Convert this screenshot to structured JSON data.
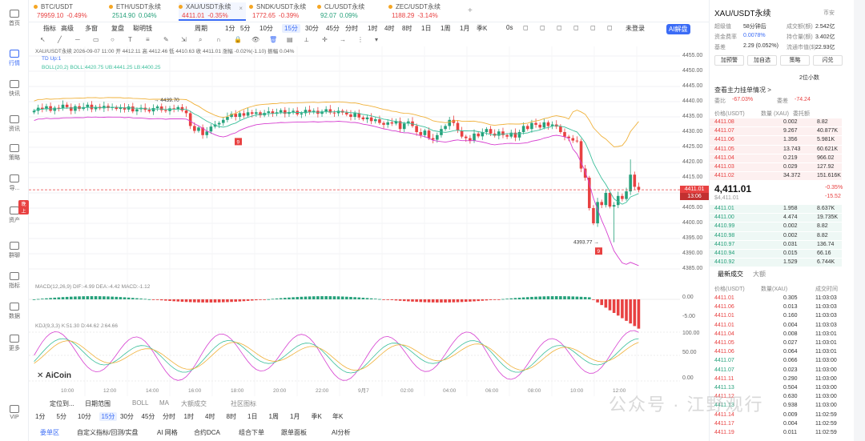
{
  "nav": [
    {
      "label": "首页",
      "icon": "home-icon"
    },
    {
      "label": "行情",
      "icon": "chart-icon"
    },
    {
      "label": "快讯",
      "icon": "flash-icon"
    },
    {
      "label": "资讯",
      "icon": "news-icon"
    },
    {
      "label": "策略",
      "icon": "strategy-icon"
    },
    {
      "label": "导...",
      "icon": "nav-icon"
    },
    {
      "label": "资产",
      "icon": "asset-icon",
      "badge": "晚上"
    },
    {
      "label": "群聊",
      "icon": "chat-icon"
    },
    {
      "label": "指标",
      "icon": "indicator-icon"
    },
    {
      "label": "数据",
      "icon": "data-icon"
    },
    {
      "label": "更多",
      "icon": "more-icon"
    },
    {
      "label": "VIP",
      "icon": "vip-icon"
    }
  ],
  "tabs": [
    {
      "name": "BTC/USDT",
      "price": "79959.10",
      "change": "-0.49%",
      "dir": "dn"
    },
    {
      "name": "ETH/USDT永续",
      "price": "2514.90",
      "change": "0.04%",
      "dir": "up"
    },
    {
      "name": "XAU/USDT永续",
      "price": "4411.01",
      "change": "-0.35%",
      "dir": "dn"
    },
    {
      "name": "SNDK/USDT永续",
      "price": "1772.65",
      "change": "-0.39%",
      "dir": "dn"
    },
    {
      "name": "CL/USDT永续",
      "price": "92.07",
      "change": "0.09%",
      "dir": "up"
    },
    {
      "name": "ZEC/USDT永续",
      "price": "1188.29",
      "change": "-3.14%",
      "dir": "dn"
    }
  ],
  "toolbar1": [
    "指标",
    "高级",
    "多窗",
    "复盘",
    "聪明钱",
    "周期",
    "1分",
    "5分",
    "10分",
    "15分",
    "30分",
    "45分",
    "分时",
    "1时",
    "4时",
    "8时",
    "1日",
    "1周",
    "1月",
    "季K",
    "0s",
    "未登录",
    "AI解盘"
  ],
  "toolbar2_label": "画线工具",
  "chart_header": {
    "symbol": "XAU/USDT永续",
    "datetime": "2026-09-07 11:00",
    "open": "开 4412.11",
    "high": "高 4412.46",
    "low": "低 4410.63",
    "close": "收 4411.01",
    "change": "涨幅 -0.02%(-1.10)",
    "amplitude": "振幅 0.04%",
    "td": "TD  Up:1",
    "boll": "BOLL(20,2)  BOLL:4420.75  UB:4441.25  LB:4400.25",
    "macd": "MACD(12,26,9)  DIF:-4.99  DEA:-4.42  MACD:-1.12",
    "kdj": "KDJ(9,3,3)  K:51.30  D:44.62  J:64.66"
  },
  "price_axis": [
    "4455.00",
    "4450.00",
    "4445.00",
    "4440.00",
    "4435.00",
    "4430.00",
    "4425.00",
    "4420.00",
    "4415.00",
    "4410.00",
    "4405.00",
    "4400.00",
    "4395.00",
    "4390.00",
    "4385.00"
  ],
  "current_price_tag": {
    "price": "4411.01",
    "countdown": "13:06"
  },
  "annotations": {
    "high_label": "4439.70",
    "low_label": "4393.77",
    "marker": "9"
  },
  "macd_axis": [
    "0.00",
    "-5.00"
  ],
  "kdj_axis": [
    "100.00",
    "50.00",
    "0.00"
  ],
  "time_axis": [
    "10:00",
    "12:00",
    "14:00",
    "16:00",
    "18:00",
    "20:00",
    "22:00",
    "9月7",
    "02:00",
    "04:00",
    "06:00",
    "08:00",
    "10:00",
    "12:00"
  ],
  "logo": "AiCoin",
  "bottom": {
    "row1": [
      "定位到...",
      "日期范围",
      "BOLL",
      "MA",
      "大额成交",
      "社区图标"
    ],
    "row2": [
      "1分",
      "5分",
      "10分",
      "15分",
      "30分",
      "45分",
      "分时",
      "1时",
      "4时",
      "8时",
      "1日",
      "1周",
      "1月",
      "季K",
      "年K"
    ],
    "row3": [
      "委单区",
      "自定义指标/回测/实盘",
      "AI 网格",
      "合约DCA",
      "组合下单",
      "跟单面板",
      "AI分析"
    ]
  },
  "right": {
    "title": "XAU/USDT永续",
    "exchange": "币安",
    "stats": [
      {
        "k": "超级值",
        "v": "58分钟后"
      },
      {
        "k": "成交额(额)",
        "v": "2.542亿"
      },
      {
        "k": "资金费率",
        "v": "0.0078%"
      },
      {
        "k": "持仓量(额)",
        "v": "3.402亿"
      },
      {
        "k": "基差",
        "v": "2.29 (0.052%)"
      },
      {
        "k": "流通市值($)",
        "v": "22.93亿"
      }
    ],
    "buttons": [
      "加预警",
      "加自选",
      "策略",
      "闪兑"
    ],
    "depth_select": "2位小数",
    "whale": "查看主力挂单情况 >",
    "ratio": {
      "k1": "委比",
      "v1": "-67.03%",
      "k2": "委差",
      "v2": "-74.24"
    },
    "book_headers": [
      "价格(USDT)",
      "数量 (XAU)",
      "委托额"
    ],
    "asks": [
      [
        "4411.08",
        "0.002",
        "8.82"
      ],
      [
        "4411.07",
        "9.267",
        "40.877K"
      ],
      [
        "4411.06",
        "1.356",
        "5.981K"
      ],
      [
        "4411.05",
        "13.743",
        "60.621K"
      ],
      [
        "4411.04",
        "0.219",
        "966.02"
      ],
      [
        "4411.03",
        "0.029",
        "127.92"
      ],
      [
        "4411.02",
        "34.372",
        "151.616K"
      ]
    ],
    "last_price": "4,411.01",
    "last_price_usd": "$4,411.01",
    "last_change": "-0.35%",
    "last_change_abs": "-15.52",
    "bids": [
      [
        "4411.01",
        "1.958",
        "8.637K"
      ],
      [
        "4411.00",
        "4.474",
        "19.735K"
      ],
      [
        "4410.99",
        "0.002",
        "8.82"
      ],
      [
        "4410.98",
        "0.002",
        "8.82"
      ],
      [
        "4410.97",
        "0.031",
        "136.74"
      ],
      [
        "4410.94",
        "0.015",
        "66.16"
      ],
      [
        "4410.92",
        "1.529",
        "6.744K"
      ]
    ],
    "trade_tabs": [
      "最新成交",
      "大额"
    ],
    "trade_headers": [
      "价格(USDT)",
      "数量(XAU)",
      "成交时间"
    ],
    "trades": [
      [
        "4411.01",
        "0.305",
        "11:03:03",
        "dn"
      ],
      [
        "4411.06",
        "0.013",
        "11:03:03",
        "dn"
      ],
      [
        "4411.01",
        "0.160",
        "11:03:03",
        "dn"
      ],
      [
        "4411.01",
        "0.004",
        "11:03:03",
        "dn"
      ],
      [
        "4411.04",
        "0.008",
        "11:03:01",
        "dn"
      ],
      [
        "4411.05",
        "0.027",
        "11:03:01",
        "dn"
      ],
      [
        "4411.06",
        "0.064",
        "11:03:01",
        "dn"
      ],
      [
        "4411.07",
        "0.066",
        "11:03:00",
        "up"
      ],
      [
        "4411.07",
        "0.023",
        "11:03:00",
        "up"
      ],
      [
        "4411.11",
        "0.290",
        "11:03:00",
        "dn"
      ],
      [
        "4411.13",
        "0.504",
        "11:03:00",
        "up"
      ],
      [
        "4411.12",
        "0.630",
        "11:03:00",
        "dn"
      ],
      [
        "4411.13",
        "0.938",
        "11:03:00",
        "up"
      ],
      [
        "4411.14",
        "0.009",
        "11:02:59",
        "dn"
      ],
      [
        "4411.17",
        "0.004",
        "11:02:59",
        "dn"
      ],
      [
        "4411.19",
        "0.011",
        "11:02:59",
        "dn"
      ]
    ]
  },
  "watermark": "公众号 · 江野观行",
  "colors": {
    "up": "#26a17b",
    "down": "#e84141",
    "accent": "#3b6cf6",
    "boll_mid": "#3bbf9b",
    "boll_up": "#f0b13a",
    "boll_low": "#d63fd0"
  }
}
